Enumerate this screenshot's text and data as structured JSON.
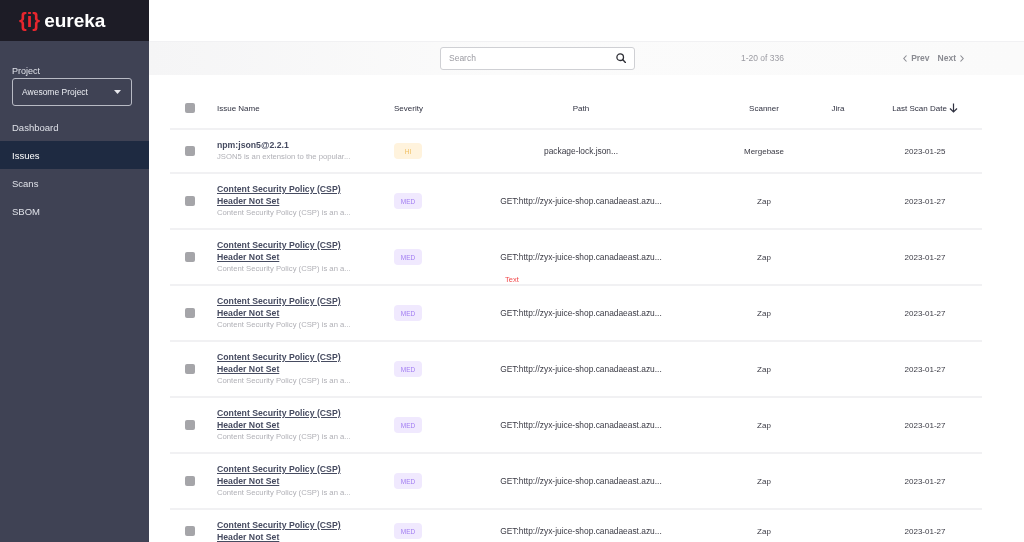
{
  "sidebar": {
    "logo": {
      "mark": "{i}",
      "name": "eureka"
    },
    "project": {
      "label": "Project",
      "value": "Awesome Project"
    },
    "nav": [
      {
        "label": "Dashboard",
        "selected": false
      },
      {
        "label": "Issues",
        "selected": true
      },
      {
        "label": "Scans",
        "selected": false
      },
      {
        "label": "SBOM",
        "selected": false
      }
    ]
  },
  "toolbar": {
    "search": {
      "placeholder": "Search"
    },
    "count": "1-20 of 336",
    "prev": "Prev",
    "next": "Next"
  },
  "table": {
    "select_all": {
      "checked": false
    },
    "columns": [
      {
        "label": "Issue Name",
        "sorted": false
      },
      {
        "label": "Severity",
        "sorted": false
      },
      {
        "label": "Path",
        "sorted": false
      },
      {
        "label": "Scanner",
        "sorted": false
      },
      {
        "label": "Jira",
        "sorted": false
      },
      {
        "label": "Last Scan Date",
        "sorted": true
      }
    ],
    "rows": [
      {
        "checked": false,
        "name": "npm:json5@2.2.1",
        "underlined": false,
        "description": "JSON5 is an extension to the popular...",
        "severity": {
          "label": "HI",
          "kind": "high"
        },
        "path": "package-lock.json...",
        "scanner": "Mergebase",
        "date": "2023-01-25"
      },
      {
        "checked": false,
        "name": "Content Security Policy (CSP) Header Not Set",
        "underlined": true,
        "description": "Content Security Policy (CSP) is an a...",
        "severity": {
          "label": "MED",
          "kind": "medium"
        },
        "path": "GET:http://zyx-juice-shop.canadaeast.azu...",
        "scanner": "Zap",
        "date": "2023-01-27"
      },
      {
        "checked": false,
        "name": "Content Security Policy (CSP) Header Not Set",
        "underlined": true,
        "description": "Content Security Policy (CSP) is an a...",
        "severity": {
          "label": "MED",
          "kind": "medium"
        },
        "path": "GET:http://zyx-juice-shop.canadaeast.azu...",
        "note": "Text",
        "scanner": "Zap",
        "date": "2023-01-27"
      },
      {
        "checked": false,
        "name": "Content Security Policy (CSP) Header Not Set",
        "underlined": true,
        "description": "Content Security Policy (CSP) is an a...",
        "severity": {
          "label": "MED",
          "kind": "medium"
        },
        "path": "GET:http://zyx-juice-shop.canadaeast.azu...",
        "scanner": "Zap",
        "date": "2023-01-27"
      },
      {
        "checked": false,
        "name": "Content Security Policy (CSP) Header Not Set",
        "underlined": true,
        "description": "Content Security Policy (CSP) is an a...",
        "severity": {
          "label": "MED",
          "kind": "medium"
        },
        "path": "GET:http://zyx-juice-shop.canadaeast.azu...",
        "scanner": "Zap",
        "date": "2023-01-27"
      },
      {
        "checked": false,
        "name": "Content Security Policy (CSP) Header Not Set",
        "underlined": true,
        "description": "Content Security Policy (CSP) is an a...",
        "severity": {
          "label": "MED",
          "kind": "medium"
        },
        "path": "GET:http://zyx-juice-shop.canadaeast.azu...",
        "scanner": "Zap",
        "date": "2023-01-27"
      },
      {
        "checked": false,
        "name": "Content Security Policy (CSP) Header Not Set",
        "underlined": true,
        "description": "Content Security Policy (CSP) is an a...",
        "severity": {
          "label": "MED",
          "kind": "medium"
        },
        "path": "GET:http://zyx-juice-shop.canadaeast.azu...",
        "scanner": "Zap",
        "date": "2023-01-27"
      },
      {
        "checked": false,
        "name": "Content Security Policy (CSP) Header Not Set",
        "underlined": true,
        "severity": {
          "label": "MED",
          "kind": "medium"
        },
        "path": "GET:http://zyx-juice-shop.canadaeast.azu...",
        "scanner": "Zap",
        "date": "2023-01-27"
      }
    ]
  }
}
